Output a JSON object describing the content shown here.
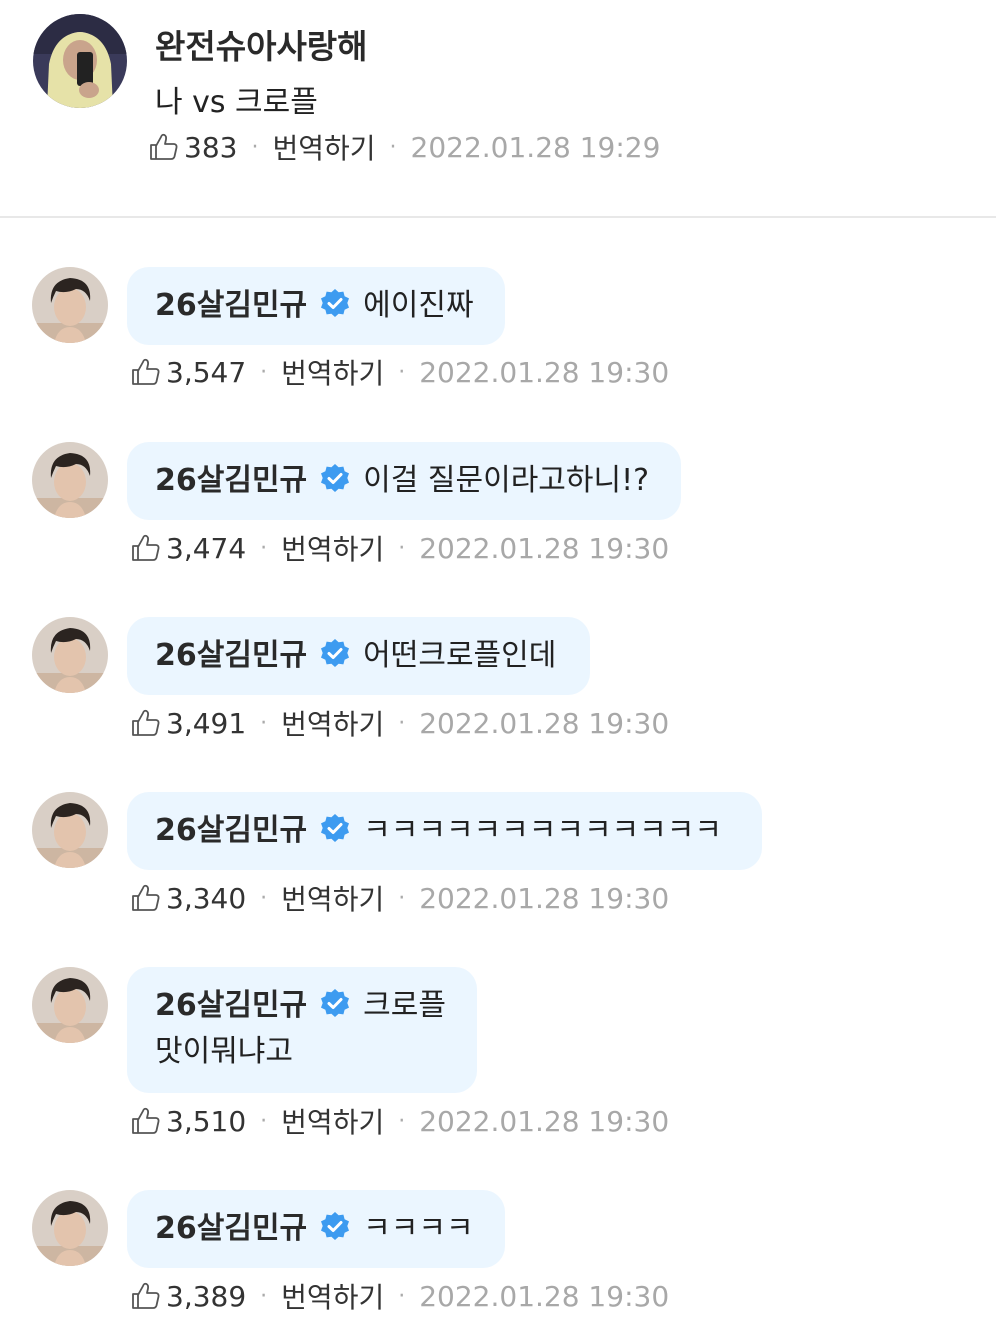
{
  "post": {
    "username": "완전슈아사랑해",
    "text": "나 vs 크로플",
    "likes": "383",
    "translate_label": "번역하기",
    "separator": "·",
    "timestamp": "2022.01.28 19:29"
  },
  "replies": [
    {
      "username": "26살김민규",
      "text": "에이진짜",
      "likes": "3,547",
      "translate_label": "번역하기",
      "timestamp": "2022.01.28 19:30"
    },
    {
      "username": "26살김민규",
      "text": "이걸 질문이라고하니!?",
      "likes": "3,474",
      "translate_label": "번역하기",
      "timestamp": "2022.01.28 19:30"
    },
    {
      "username": "26살김민규",
      "text": "어떤크로플인데",
      "likes": "3,491",
      "translate_label": "번역하기",
      "timestamp": "2022.01.28 19:30"
    },
    {
      "username": "26살김민규",
      "text": "ㅋㅋㅋㅋㅋㅋㅋㅋㅋㅋㅋㅋㅋ",
      "likes": "3,340",
      "translate_label": "번역하기",
      "timestamp": "2022.01.28 19:30"
    },
    {
      "username": "26살김민규",
      "text": "크로플 맛이뭐냐고",
      "likes": "3,510",
      "translate_label": "번역하기",
      "timestamp": "2022.01.28 19:30"
    },
    {
      "username": "26살김민규",
      "text": "ㅋㅋㅋㅋ",
      "likes": "3,389",
      "translate_label": "번역하기",
      "timestamp": "2022.01.28 19:30"
    }
  ],
  "icons": {
    "like": "thumbs-up-icon",
    "verified": "verified-badge-icon"
  },
  "colors": {
    "bubble_background": "#ebf6ff",
    "verified_badge": "#3d9bf0",
    "timestamp": "#a8a8a8",
    "divider": "#e8e8e8"
  }
}
